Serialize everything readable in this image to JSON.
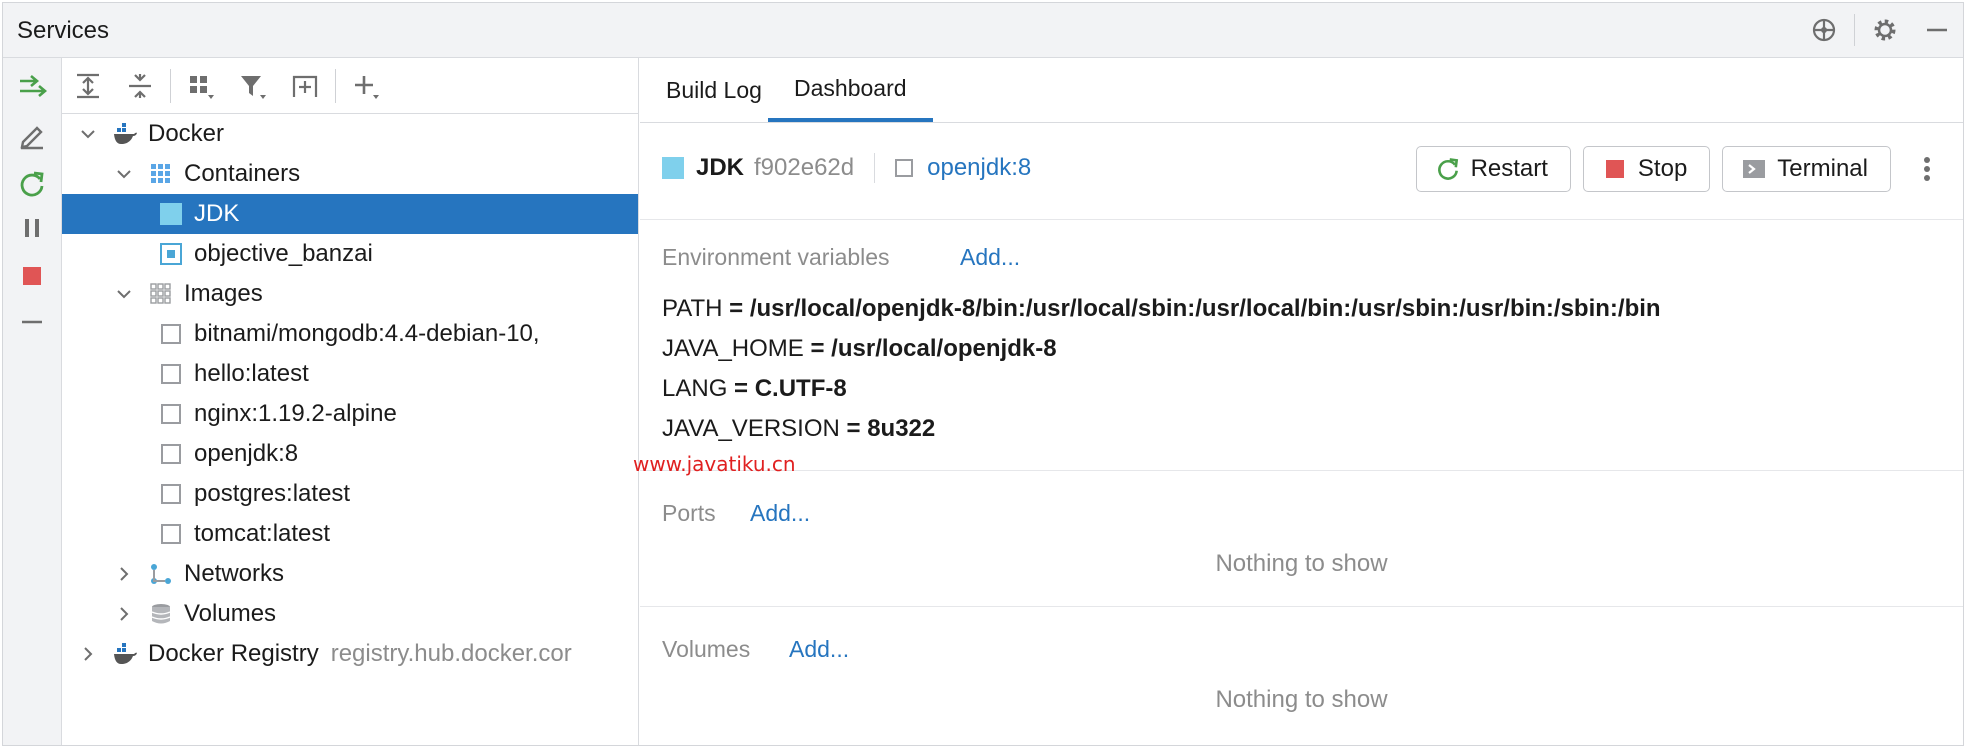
{
  "window": {
    "title": "Services"
  },
  "tree_toolbar": [
    "expand-all",
    "collapse-all",
    "group-by",
    "filter",
    "new-tab",
    "add"
  ],
  "tree": [
    {
      "label": "Docker",
      "level": 0,
      "expanded": true,
      "icon": "docker-icon"
    },
    {
      "label": "Containers",
      "level": 1,
      "expanded": true,
      "icon": "containers-icon"
    },
    {
      "label": "JDK",
      "level": 2,
      "icon": "container-running-icon",
      "selected": true
    },
    {
      "label": "objective_banzai",
      "level": 2,
      "icon": "container-icon"
    },
    {
      "label": "Images",
      "level": 1,
      "expanded": true,
      "icon": "images-icon"
    },
    {
      "label": "bitnami/mongodb:4.4-debian-10,",
      "level": 2,
      "icon": "image-icon"
    },
    {
      "label": "hello:latest",
      "level": 2,
      "icon": "image-icon"
    },
    {
      "label": "nginx:1.19.2-alpine",
      "level": 2,
      "icon": "image-icon"
    },
    {
      "label": "openjdk:8",
      "level": 2,
      "icon": "image-icon"
    },
    {
      "label": "postgres:latest",
      "level": 2,
      "icon": "image-icon"
    },
    {
      "label": "tomcat:latest",
      "level": 2,
      "icon": "image-icon"
    },
    {
      "label": "Networks",
      "level": 1,
      "expanded": false,
      "icon": "networks-icon"
    },
    {
      "label": "Volumes",
      "level": 1,
      "expanded": false,
      "icon": "volumes-icon"
    },
    {
      "label": "Docker Registry",
      "level": 0,
      "expanded": false,
      "icon": "docker-icon",
      "sub": "registry.hub.docker.cor"
    }
  ],
  "tabs": [
    "Build Log",
    "Dashboard"
  ],
  "active_tab": "Dashboard",
  "container": {
    "name": "JDK",
    "id": "f902e62d",
    "image": "openjdk:8"
  },
  "actions": {
    "restart": "Restart",
    "stop": "Stop",
    "terminal": "Terminal"
  },
  "env_section": {
    "label": "Environment variables",
    "add": "Add..."
  },
  "env_vars": [
    {
      "key": "PATH",
      "value": "/usr/local/openjdk-8/bin:/usr/local/sbin:/usr/local/bin:/usr/sbin:/usr/bin:/sbin:/bin"
    },
    {
      "key": "JAVA_HOME",
      "value": "/usr/local/openjdk-8"
    },
    {
      "key": "LANG",
      "value": "C.UTF-8"
    },
    {
      "key": "JAVA_VERSION",
      "value": "8u322"
    }
  ],
  "ports_section": {
    "label": "Ports",
    "add": "Add...",
    "empty": "Nothing to show"
  },
  "volumes_section": {
    "label": "Volumes",
    "add": "Add...",
    "empty": "Nothing to show"
  },
  "watermark": "www.javatiku.cn",
  "colors": {
    "accent": "#2675bf",
    "selection": "#2675bf",
    "stop": "#e05555",
    "run": "#4aa04a"
  }
}
